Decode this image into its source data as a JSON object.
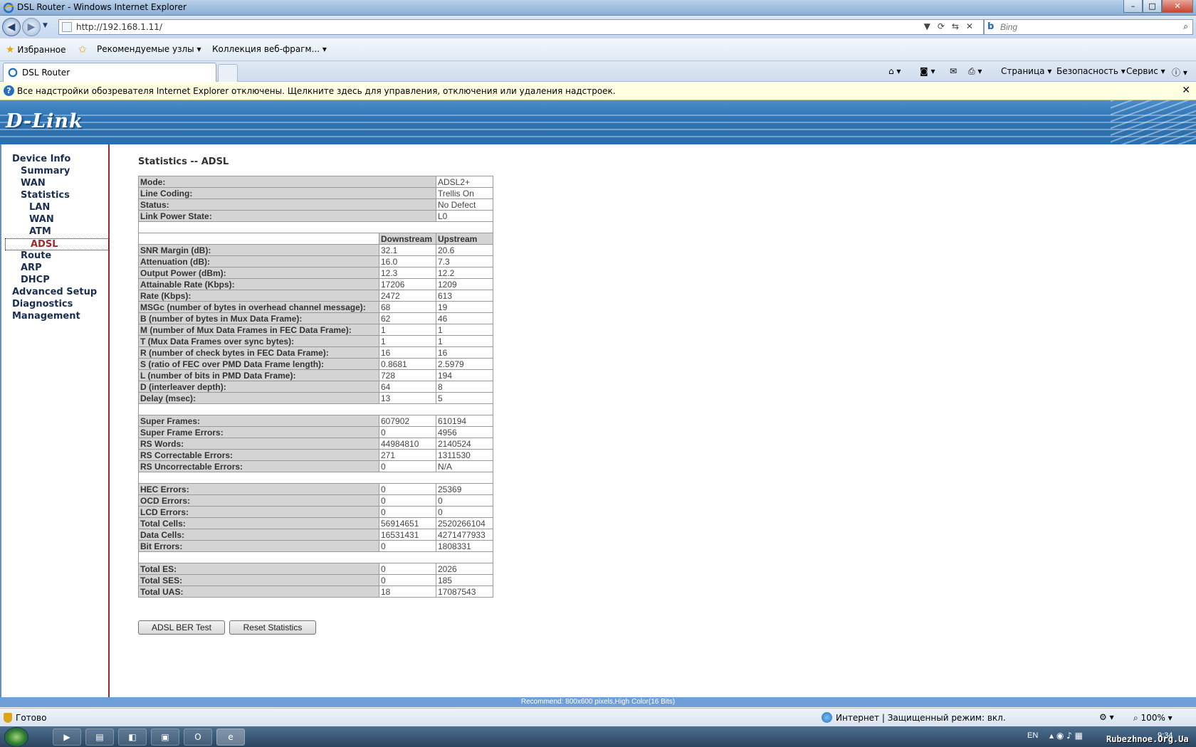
{
  "window": {
    "title": "DSL Router - Windows Internet Explorer"
  },
  "address": {
    "url": "http://192.168.1.11/",
    "search_placeholder": "Bing"
  },
  "favorites_bar": {
    "favorites": "Избранное",
    "recommended": "Рекомендуемые узлы",
    "collection": "Коллекция веб-фрагм..."
  },
  "tab": {
    "label": "DSL Router"
  },
  "command_bar": {
    "page": "Страница",
    "security": "Безопасность",
    "service": "Сервис"
  },
  "infobar": {
    "message": "Все надстройки обозревателя Internet Explorer отключены. Щелкните здесь для управления, отключения или удаления надстроек."
  },
  "brand": {
    "logo": "D-Link"
  },
  "sidebar": {
    "device_info": "Device Info",
    "summary": "Summary",
    "wan": "WAN",
    "statistics": "Statistics",
    "lan": "LAN",
    "stats_wan": "WAN",
    "atm": "ATM",
    "adsl": "ADSL",
    "route": "Route",
    "arp": "ARP",
    "dhcp": "DHCP",
    "advanced_setup": "Advanced Setup",
    "diagnostics": "Diagnostics",
    "management": "Management"
  },
  "main": {
    "title": "Statistics -- ADSL",
    "info_rows": [
      {
        "label": "Mode:",
        "value": "ADSL2+"
      },
      {
        "label": "Line Coding:",
        "value": "Trellis On"
      },
      {
        "label": "Status:",
        "value": "No Defect"
      },
      {
        "label": "Link Power State:",
        "value": "L0"
      }
    ],
    "col_downstream": "Downstream",
    "col_upstream": "Upstream",
    "groups": [
      [
        {
          "label": "SNR Margin (dB):",
          "down": "32.1",
          "up": "20.6"
        },
        {
          "label": "Attenuation (dB):",
          "down": "16.0",
          "up": "7.3"
        },
        {
          "label": "Output Power (dBm):",
          "down": "12.3",
          "up": "12.2"
        },
        {
          "label": "Attainable Rate (Kbps):",
          "down": "17206",
          "up": "1209"
        },
        {
          "label": "Rate (Kbps):",
          "down": "2472",
          "up": "613"
        },
        {
          "label": "MSGc (number of bytes in overhead channel message):",
          "down": "68",
          "up": "19"
        },
        {
          "label": "B (number of bytes in Mux Data Frame):",
          "down": "62",
          "up": "46"
        },
        {
          "label": "M (number of Mux Data Frames in FEC Data Frame):",
          "down": "1",
          "up": "1"
        },
        {
          "label": "T (Mux Data Frames over sync bytes):",
          "down": "1",
          "up": "1"
        },
        {
          "label": "R (number of check bytes in FEC Data Frame):",
          "down": "16",
          "up": "16"
        },
        {
          "label": "S (ratio of FEC over PMD Data Frame length):",
          "down": "0.8681",
          "up": "2.5979"
        },
        {
          "label": "L (number of bits in PMD Data Frame):",
          "down": "728",
          "up": "194"
        },
        {
          "label": "D (interleaver depth):",
          "down": "64",
          "up": "8"
        },
        {
          "label": "Delay (msec):",
          "down": "13",
          "up": "5"
        }
      ],
      [
        {
          "label": "Super Frames:",
          "down": "607902",
          "up": "610194"
        },
        {
          "label": "Super Frame Errors:",
          "down": "0",
          "up": "4956"
        },
        {
          "label": "RS Words:",
          "down": "44984810",
          "up": "2140524"
        },
        {
          "label": "RS Correctable Errors:",
          "down": "271",
          "up": "1311530"
        },
        {
          "label": "RS Uncorrectable Errors:",
          "down": "0",
          "up": "N/A"
        }
      ],
      [
        {
          "label": "HEC Errors:",
          "down": "0",
          "up": "25369"
        },
        {
          "label": "OCD Errors:",
          "down": "0",
          "up": "0"
        },
        {
          "label": "LCD Errors:",
          "down": "0",
          "up": "0"
        },
        {
          "label": "Total Cells:",
          "down": "56914651",
          "up": "2520266104"
        },
        {
          "label": "Data Cells:",
          "down": "16531431",
          "up": "4271477933"
        },
        {
          "label": "Bit Errors:",
          "down": "0",
          "up": "1808331"
        }
      ],
      [
        {
          "label": "Total ES:",
          "down": "0",
          "up": "2026"
        },
        {
          "label": "Total SES:",
          "down": "0",
          "up": "185"
        },
        {
          "label": "Total UAS:",
          "down": "18",
          "up": "17087543"
        }
      ]
    ],
    "ber_test_button": "ADSL BER Test",
    "reset_button": "Reset Statistics",
    "recommend": "Recommend: 800x600 pixels,High Color(16 Bits)"
  },
  "statusbar": {
    "done": "Готово",
    "zone": "Интернет | Защищенный режим: вкл.",
    "zoom": "100%"
  },
  "taskbar": {
    "lang": "EN",
    "time": "9:34",
    "watermark": "Rubezhnoe.Org.Ua"
  }
}
